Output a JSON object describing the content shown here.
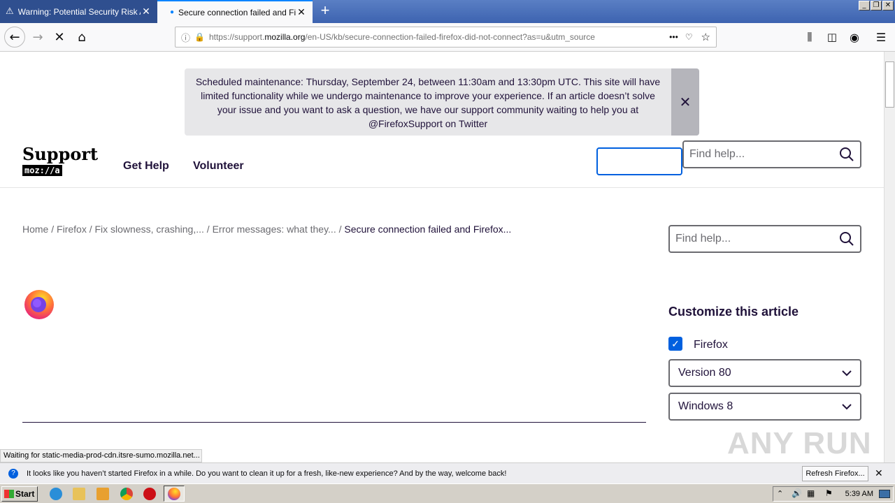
{
  "browser": {
    "tabs": [
      {
        "title": "Warning: Potential Security Risk Ahead",
        "close": "✕",
        "warning_icon": "warning-triangle-icon"
      },
      {
        "title": "Secure connection failed and Firefox did not connect",
        "close": "✕",
        "loading": true
      }
    ],
    "new_tab": "+",
    "window_buttons": {
      "minimize": "_",
      "restore": "❐",
      "close": "✕"
    },
    "url": {
      "prefix": "https://support.",
      "host": "mozilla.org",
      "suffix": "/en-US/kb/secure-connection-failed-firefox-did-not-connect?as=u&utm_source",
      "more": "•••"
    }
  },
  "banner": {
    "text": "Scheduled maintenance: Thursday, September 24, between 11:30am and 13:30pm UTC. This site will have limited functionality while we undergo maintenance to improve your experience. If an article doesn’t solve your issue and you want to ask a question, we have our support community waiting to help you at @FirefoxSupport on Twitter",
    "close": "✕"
  },
  "header": {
    "logo_top": "Support",
    "logo_bottom": "moz://a",
    "nav": [
      "Get Help",
      "Volunteer"
    ],
    "search_placeholder": "Find help..."
  },
  "breadcrumb": {
    "items": [
      "Home",
      "Firefox",
      "Fix slowness, crashing,...",
      "Error messages: what they..."
    ],
    "current": "Secure connection failed and Firefox...",
    "sep": " / "
  },
  "sidebar": {
    "search_placeholder": "Find help...",
    "customize_title": "Customize this article",
    "product_checkbox": {
      "label": "Firefox",
      "checked": true
    },
    "version_select": "Version 80",
    "os_select": "Windows 8"
  },
  "status_text": "Waiting for static-media-prod-cdn.itsre-sumo.mozilla.net...",
  "watermark": "ANY RUN",
  "notification": {
    "text": "It looks like you haven’t started Firefox in a while. Do you want to clean it up for a fresh, like-new experience? And by the way, welcome back!",
    "button": "Refresh Firefox...",
    "close": "✕"
  },
  "taskbar": {
    "start": "Start",
    "clock": "5:39 AM"
  },
  "colors": {
    "accent": "#0060df",
    "title_bar": "#3d63b0",
    "banner_bg": "#e7e7e9"
  }
}
